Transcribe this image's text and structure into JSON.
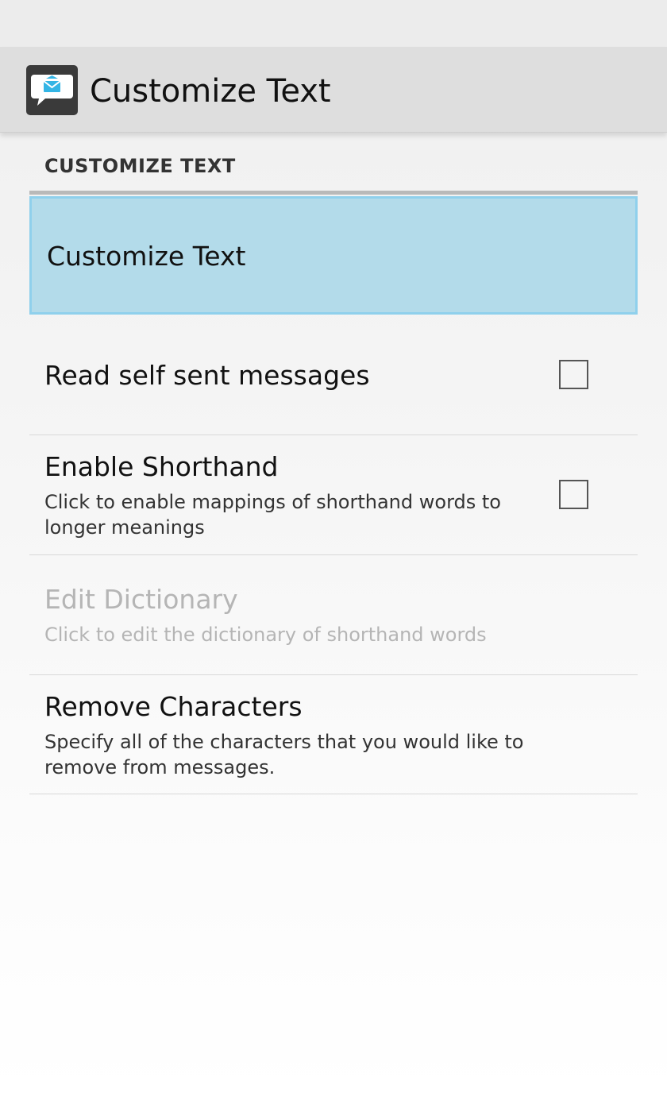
{
  "action_bar": {
    "title": "Customize Text",
    "icon": "message-bubble-icon",
    "icon_color": "#33b5e5"
  },
  "category": {
    "title": "CUSTOMIZE TEXT"
  },
  "preferences": [
    {
      "title": "Customize Text",
      "summary": "",
      "selected": true,
      "enabled": true
    },
    {
      "title": "Read self sent messages",
      "summary": "",
      "checkbox": true,
      "checked": false,
      "enabled": true
    },
    {
      "title": "Enable Shorthand",
      "summary": "Click to enable mappings of shorthand words to longer meanings",
      "checkbox": true,
      "checked": false,
      "enabled": true
    },
    {
      "title": "Edit Dictionary",
      "summary": "Click to edit the dictionary of shorthand words",
      "enabled": false
    },
    {
      "title": "Remove Characters",
      "summary": "Specify all of the characters that you would like to remove from messages.",
      "enabled": true
    }
  ],
  "colors": {
    "selected_bg": "#b3dbea",
    "selected_border": "#8fd0ec",
    "disabled_text": "#b5b5b5"
  }
}
